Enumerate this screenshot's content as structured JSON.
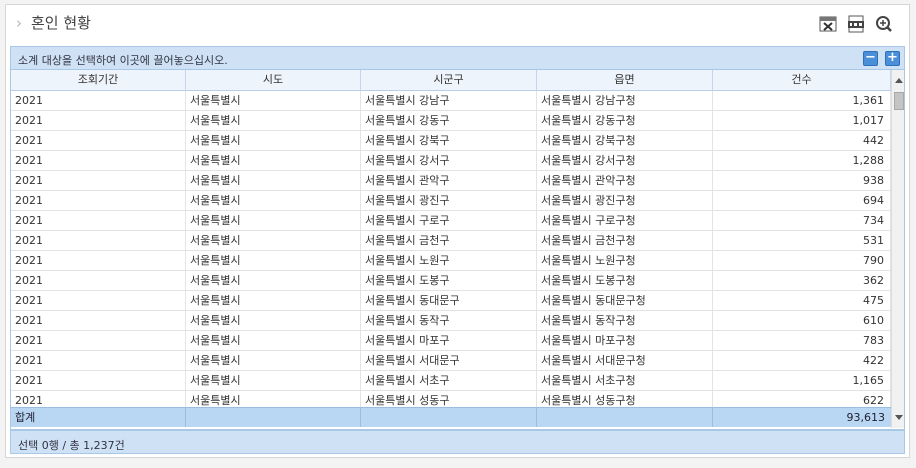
{
  "title": {
    "text": "혼인 현황"
  },
  "toolbar": {
    "icons": [
      "excel-export-icon",
      "pdf-export-icon",
      "zoom-icon"
    ]
  },
  "group_bar": {
    "text": "소계 대상을 선택하여 이곳에 끌어놓으십시오.",
    "minus_label": "−",
    "plus_label": "+"
  },
  "grid": {
    "columns": [
      "조회기간",
      "시도",
      "시군구",
      "읍면",
      "건수"
    ],
    "rows": [
      [
        "2021",
        "서울특별시",
        "서울특별시 강남구",
        "서울특별시 강남구청",
        "1,361"
      ],
      [
        "2021",
        "서울특별시",
        "서울특별시 강동구",
        "서울특별시 강동구청",
        "1,017"
      ],
      [
        "2021",
        "서울특별시",
        "서울특별시 강북구",
        "서울특별시 강북구청",
        "442"
      ],
      [
        "2021",
        "서울특별시",
        "서울특별시 강서구",
        "서울특별시 강서구청",
        "1,288"
      ],
      [
        "2021",
        "서울특별시",
        "서울특별시 관악구",
        "서울특별시 관악구청",
        "938"
      ],
      [
        "2021",
        "서울특별시",
        "서울특별시 광진구",
        "서울특별시 광진구청",
        "694"
      ],
      [
        "2021",
        "서울특별시",
        "서울특별시 구로구",
        "서울특별시 구로구청",
        "734"
      ],
      [
        "2021",
        "서울특별시",
        "서울특별시 금천구",
        "서울특별시 금천구청",
        "531"
      ],
      [
        "2021",
        "서울특별시",
        "서울특별시 노원구",
        "서울특별시 노원구청",
        "790"
      ],
      [
        "2021",
        "서울특별시",
        "서울특별시 도봉구",
        "서울특별시 도봉구청",
        "362"
      ],
      [
        "2021",
        "서울특별시",
        "서울특별시 동대문구",
        "서울특별시 동대문구청",
        "475"
      ],
      [
        "2021",
        "서울특별시",
        "서울특별시 동작구",
        "서울특별시 동작구청",
        "610"
      ],
      [
        "2021",
        "서울특별시",
        "서울특별시 마포구",
        "서울특별시 마포구청",
        "783"
      ],
      [
        "2021",
        "서울특별시",
        "서울특별시 서대문구",
        "서울특별시 서대문구청",
        "422"
      ],
      [
        "2021",
        "서울특별시",
        "서울특별시 서초구",
        "서울특별시 서초구청",
        "1,165"
      ],
      [
        "2021",
        "서울특별시",
        "서울특별시 성동구",
        "서울특별시 성동구청",
        "622"
      ]
    ],
    "summary": {
      "label": "합계",
      "total": "93,613"
    }
  },
  "status": {
    "text": "선택 0행 / 총 1,237건"
  },
  "colors": {
    "accent": "#4a8fd8",
    "bar_bg": "#cfe2f5",
    "summary_bg": "#b9d6f2"
  }
}
